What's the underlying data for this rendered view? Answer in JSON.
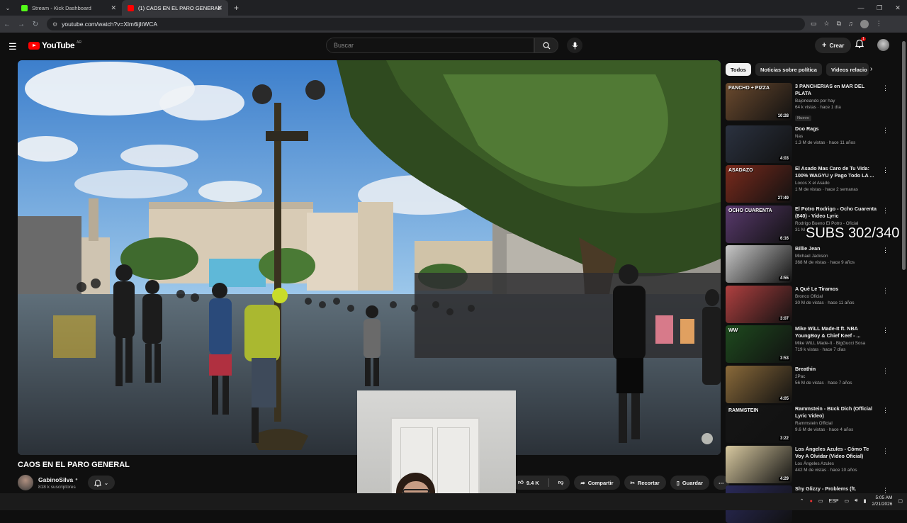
{
  "browser": {
    "tabs": [
      {
        "title": "Stream - Kick Dashboard",
        "favicon_color": "#53fc18"
      },
      {
        "title": "(1) CAOS EN EL PARO GENERAL",
        "favicon_color": "#ff0000"
      }
    ],
    "url": "youtube.com/watch?v=Xlm6ijItWCA"
  },
  "header": {
    "logo": "YouTube",
    "logo_region": "AR",
    "search_placeholder": "Buscar",
    "create_label": "Crear",
    "notification_count": "1"
  },
  "video": {
    "title": "CAOS EN EL PARO GENERAL",
    "channel": "GabinoSilva",
    "subscribers": "818 k suscriptores",
    "likes": "9.4 K",
    "share_label": "Compartir",
    "clip_label": "Recortar",
    "save_label": "Guardar"
  },
  "chips": [
    "Todos",
    "Noticias sobre política",
    "Videos relacio"
  ],
  "recommendations": [
    {
      "title": "3 PANCHERIAS en MAR DEL PLATA",
      "channel": "Bajoneando por hay",
      "meta": "64 k vistas · hace 1 día",
      "badge": "Nuevo",
      "duration": "10:28",
      "thumb_color": "#6b4a2e",
      "thumb_text": "PANCHO + PIZZA"
    },
    {
      "title": "Doo Rags",
      "channel": "Nas",
      "meta": "1.3 M de vistas · hace 11 años",
      "badge": "",
      "duration": "4:03",
      "thumb_color": "#2b3240",
      "thumb_text": ""
    },
    {
      "title": "El Asado Mas Caro de Tu Vida: 100% WAGYU y Pago Todo LA ...",
      "channel": "Locos X el Asado",
      "meta": "1 M de vistas · hace 2 semanas",
      "badge": "",
      "duration": "27:49",
      "thumb_color": "#7a2a1c",
      "thumb_text": "ASADAZO"
    },
    {
      "title": "El Potro Rodrigo - Ocho Cuarenta (840) - Video Lyric",
      "channel": "Rodrigo Bueno El Potro - Oficial",
      "meta": "31 M",
      "badge": "",
      "duration": "6:16",
      "thumb_color": "#5a3a6e",
      "thumb_text": "OCHO CUARENTA"
    },
    {
      "title": "Billie Jean",
      "channel": "Michael Jackson",
      "meta": "368 M de vistas · hace 9 años",
      "badge": "",
      "duration": "4:55",
      "thumb_color": "#c8c8c8",
      "thumb_text": ""
    },
    {
      "title": "A Qué Le Tiramos",
      "channel": "Bronco Oficial",
      "meta": "30 M de vistas · hace 11 años",
      "badge": "",
      "duration": "3:07",
      "thumb_color": "#b04040",
      "thumb_text": ""
    },
    {
      "title": "Mike WiLL Made-It ft. NBA YoungBoy & Chief Keef - ...",
      "channel": "Mike WiLL Made-It · BigGucci Sosa",
      "meta": "719 k vistas · hace 7 días",
      "badge": "",
      "duration": "3:53",
      "thumb_color": "#1e4a1e",
      "thumb_text": "WW"
    },
    {
      "title": "Breathin",
      "channel": "2Pac",
      "meta": "56 M de vistas · hace 7 años",
      "badge": "",
      "duration": "4:05",
      "thumb_color": "#8a6a3a",
      "thumb_text": ""
    },
    {
      "title": "Rammstein - Bück Dich (Official Lyric Video)",
      "channel": "Rammstein Official",
      "meta": "9.6 M de vistas · hace 4 años",
      "badge": "",
      "duration": "3:22",
      "thumb_color": "#151515",
      "thumb_text": "RAMMSTEIN"
    },
    {
      "title": "Los Ángeles Azules - Cómo Te Voy A Olvidar (Video Oficial)",
      "channel": "Los Ángeles Azules",
      "meta": "442 M de vistas · hace 10 años",
      "badge": "",
      "duration": "4:29",
      "thumb_color": "#d8c9a0",
      "thumb_text": ""
    },
    {
      "title": "Shy Glizzy - Problems (ft.",
      "channel": "",
      "meta": "",
      "badge": "",
      "duration": "",
      "thumb_color": "#2a2a5a",
      "thumb_text": ""
    }
  ],
  "overlay": {
    "subs_text": "SUBS 302/340"
  },
  "taskbar": {
    "lang": "ESP",
    "time": "5:05 AM",
    "date": "2/21/2026"
  }
}
